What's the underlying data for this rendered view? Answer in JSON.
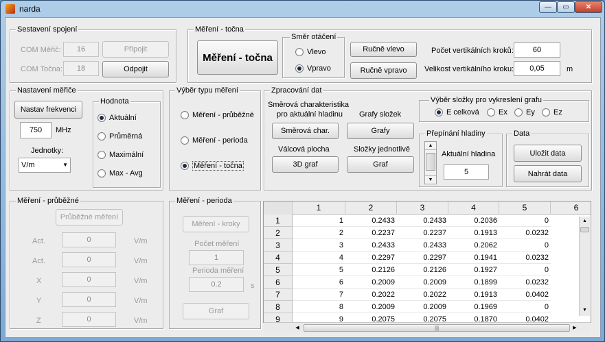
{
  "window": {
    "title": "narda"
  },
  "spojeni": {
    "title": "Sestavení spojení",
    "com_meric_label": "COM Měřič:",
    "com_meric_value": "16",
    "com_tocna_label": "COM Točna:",
    "com_tocna_value": "18",
    "pripojit": "Připojit",
    "odpojit": "Odpojit"
  },
  "mereni_tocna": {
    "title": "Měření - točna",
    "big_button": "Měření - točna",
    "smer_title": "Směr otáčení",
    "vlevo": "Vlevo",
    "vpravo": "Vpravo",
    "selected": "Vpravo",
    "rucne_vlevo": "Ručně vlevo",
    "rucne_vpravo": "Ručně vpravo",
    "pocet_label": "Počet vertikálních kroků:",
    "pocet_value": "60",
    "velikost_label": "Velikost vertikálního kroku:",
    "velikost_value": "0,05",
    "velikost_unit": "m"
  },
  "nastaveni": {
    "title": "Nastavení měřiče",
    "nastav_frekvenci": "Nastav frekvenci",
    "freq_value": "750",
    "freq_unit": "MHz",
    "jednotky_label": "Jednotky:",
    "jednotky_value": "V/m",
    "hodnota_title": "Hodnota",
    "options": [
      "Aktuální",
      "Průměrná",
      "Maximální",
      "Max - Avg"
    ],
    "selected": "Aktuální"
  },
  "vyber_typu": {
    "title": "Výběr typu měření",
    "options": [
      "Měření - průběžné",
      "Měření - perioda",
      "Měření - točna"
    ],
    "selected": "Měření - točna"
  },
  "zpracovani": {
    "title": "Zpracování dat",
    "smerova_label_1": "Směrová charakteristika",
    "smerova_label_2": "pro aktuální hladinu",
    "smerova_button": "Směrová char.",
    "grafy_label": "Grafy složek",
    "grafy_button": "Grafy",
    "valcova_label": "Válcová plocha",
    "graf3d_button": "3D graf",
    "slozky_label": "Složky jednotlivě",
    "graf_button": "Graf",
    "vyber_slozky_title": "Výběr složky pro vykreslení grafu",
    "slozky_options": [
      "E celková",
      "Ex",
      "Ey",
      "Ez"
    ],
    "slozky_selected": "E celková",
    "prepinani_title": "Přepínání hladiny",
    "aktualni_label": "Aktuální hladina",
    "aktualni_value": "5",
    "data_title": "Data",
    "ulozit": "Uložit data",
    "nahrat": "Nahrát data"
  },
  "prubezne": {
    "title": "Měření - průběžné",
    "button": "Průběžné měření",
    "rows": [
      {
        "label": "Act.",
        "value": "0",
        "unit": "V/m"
      },
      {
        "label": "Act.",
        "value": "0",
        "unit": "V/m"
      },
      {
        "label": "X",
        "value": "0",
        "unit": "V/m"
      },
      {
        "label": "Y",
        "value": "0",
        "unit": "V/m"
      },
      {
        "label": "Z",
        "value": "0",
        "unit": "V/m"
      }
    ]
  },
  "perioda": {
    "title": "Měření - perioda",
    "button": "Měření - kroky",
    "pocet_label": "Počet měření",
    "pocet_value": "1",
    "perioda_label": "Perioda měření",
    "perioda_value": "0.2",
    "perioda_unit": "s",
    "graf_button": "Graf"
  },
  "table": {
    "columns": [
      "1",
      "2",
      "3",
      "4",
      "5",
      "6"
    ],
    "rows": [
      [
        "1",
        "0.2433",
        "0.2433",
        "0.2036",
        "0"
      ],
      [
        "2",
        "0.2237",
        "0.2237",
        "0.1913",
        "0.0232"
      ],
      [
        "3",
        "0.2433",
        "0.2433",
        "0.2062",
        "0"
      ],
      [
        "4",
        "0.2297",
        "0.2297",
        "0.1941",
        "0.0232"
      ],
      [
        "5",
        "0.2126",
        "0.2126",
        "0.1927",
        "0"
      ],
      [
        "6",
        "0.2009",
        "0.2009",
        "0.1899",
        "0.0232"
      ],
      [
        "7",
        "0.2022",
        "0.2022",
        "0.1913",
        "0.0402"
      ],
      [
        "8",
        "0.2009",
        "0.2009",
        "0.1969",
        "0"
      ],
      [
        "9",
        "0.2075",
        "0.2075",
        "0.1870",
        "0.0402"
      ]
    ],
    "row_headers": [
      "1",
      "2",
      "3",
      "4",
      "5",
      "6",
      "7",
      "8",
      "9"
    ]
  }
}
